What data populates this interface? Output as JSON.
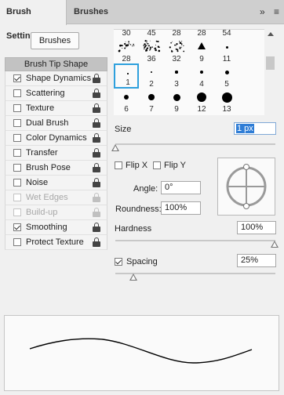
{
  "tabs": {
    "active": "Brush Settings",
    "inactive": "Brushes"
  },
  "header_icons": {
    "expand": "»",
    "menu": "≡"
  },
  "brushes_button": "Brushes",
  "list_header": "Brush Tip Shape",
  "list_items": [
    {
      "label": "Shape Dynamics",
      "checked": true,
      "enabled": true
    },
    {
      "label": "Scattering",
      "checked": false,
      "enabled": true
    },
    {
      "label": "Texture",
      "checked": false,
      "enabled": true
    },
    {
      "label": "Dual Brush",
      "checked": false,
      "enabled": true
    },
    {
      "label": "Color Dynamics",
      "checked": false,
      "enabled": true
    },
    {
      "label": "Transfer",
      "checked": false,
      "enabled": true
    },
    {
      "label": "Brush Pose",
      "checked": false,
      "enabled": true
    },
    {
      "label": "Noise",
      "checked": false,
      "enabled": true
    },
    {
      "label": "Wet Edges",
      "checked": false,
      "enabled": false
    },
    {
      "label": "Build-up",
      "checked": false,
      "enabled": false
    },
    {
      "label": "Smoothing",
      "checked": true,
      "enabled": true
    },
    {
      "label": "Protect Texture",
      "checked": false,
      "enabled": true
    }
  ],
  "brush_presets": {
    "top_partial_labels": [
      "30",
      "45",
      "28",
      "28",
      "54"
    ],
    "items": [
      "28",
      "36",
      "32",
      "9",
      "11",
      "1",
      "2",
      "3",
      "4",
      "5",
      "6",
      "7",
      "9",
      "12",
      "13"
    ],
    "selected": "1"
  },
  "size": {
    "label": "Size",
    "value": "1 px"
  },
  "flip": {
    "x_label": "Flip X",
    "y_label": "Flip Y",
    "x_checked": false,
    "y_checked": false
  },
  "angle": {
    "label": "Angle:",
    "value": "0°"
  },
  "roundness": {
    "label": "Roundness:",
    "value": "100%"
  },
  "hardness": {
    "label": "Hardness",
    "value": "100%"
  },
  "spacing": {
    "label": "Spacing",
    "value": "25%",
    "checked": true
  },
  "colors": {
    "accent": "#2ea0dd",
    "selection": "#2f7dd6"
  }
}
